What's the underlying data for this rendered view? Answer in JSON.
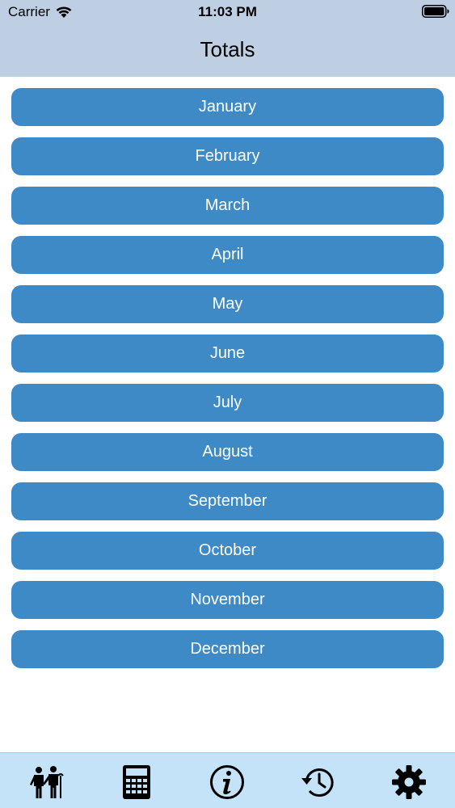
{
  "status_bar": {
    "carrier": "Carrier",
    "time": "11:03 PM",
    "wifi_icon": "wifi-icon",
    "battery_icon": "battery-icon"
  },
  "header": {
    "title": "Totals",
    "background": "#bfcfe3"
  },
  "months": [
    {
      "label": "January"
    },
    {
      "label": "February"
    },
    {
      "label": "March"
    },
    {
      "label": "April"
    },
    {
      "label": "May"
    },
    {
      "label": "June"
    },
    {
      "label": "July"
    },
    {
      "label": "August"
    },
    {
      "label": "September"
    },
    {
      "label": "October"
    },
    {
      "label": "November"
    },
    {
      "label": "December"
    }
  ],
  "tab_bar": {
    "background": "#c4e3f9",
    "tabs": [
      {
        "icon": "people-icon"
      },
      {
        "icon": "calculator-icon"
      },
      {
        "icon": "info-icon"
      },
      {
        "icon": "history-icon"
      },
      {
        "icon": "gear-icon"
      }
    ]
  },
  "colors": {
    "button": "#3d8ac6",
    "button_text": "#ffffff"
  }
}
